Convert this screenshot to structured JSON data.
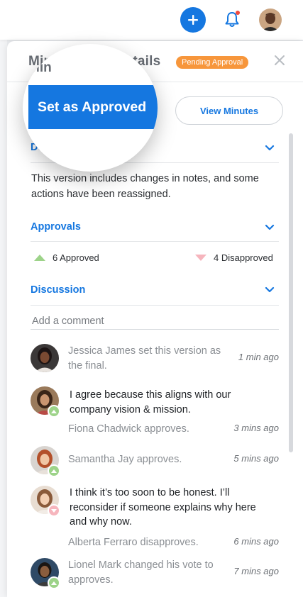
{
  "header": {
    "add_icon": "plus-icon",
    "notification_icon": "bell-icon",
    "colors": {
      "accent": "#1577e0",
      "alert_dot": "#f04a3e"
    }
  },
  "panel": {
    "title": "Minutes Details",
    "title_visible": "Min",
    "title_visible_tail": "tails",
    "status_badge": "Pending Approval",
    "close_icon": "close-icon",
    "set_approved_label": "Set as Approved",
    "view_minutes_label": "View Minutes"
  },
  "description": {
    "title": "De",
    "text": "This version includes changes in notes, and some actions have been reassigned."
  },
  "approvals": {
    "title": "Approvals",
    "approved_label": "6 Approved",
    "disapproved_label": "4 Disapproved"
  },
  "discussion": {
    "title": "Discussion",
    "comment_placeholder": "Add a comment",
    "items": [
      {
        "text": "Jessica James set this version as the final.",
        "time": "1 min ago"
      },
      {
        "comment": "I agree because this aligns with our company vision & mission.",
        "text": "Fiona Chadwick approves.",
        "time": "3 mins ago",
        "vote": "approve"
      },
      {
        "text": "Samantha Jay approves.",
        "time": "5 mins ago",
        "vote": "approve"
      },
      {
        "comment": "I think it’s too soon to be honest. I’ll reconsider if someone explains why here and why now.",
        "text": "Alberta Ferraro disapproves.",
        "time": "6 mins ago",
        "vote": "disapprove"
      },
      {
        "text": "Lionel Mark changed his vote to approves.",
        "time": "7 mins ago",
        "vote": "approve"
      }
    ]
  },
  "colors": {
    "badge": "#f7963b",
    "approve": "#9dd389",
    "disapprove": "#f6b5bd"
  }
}
